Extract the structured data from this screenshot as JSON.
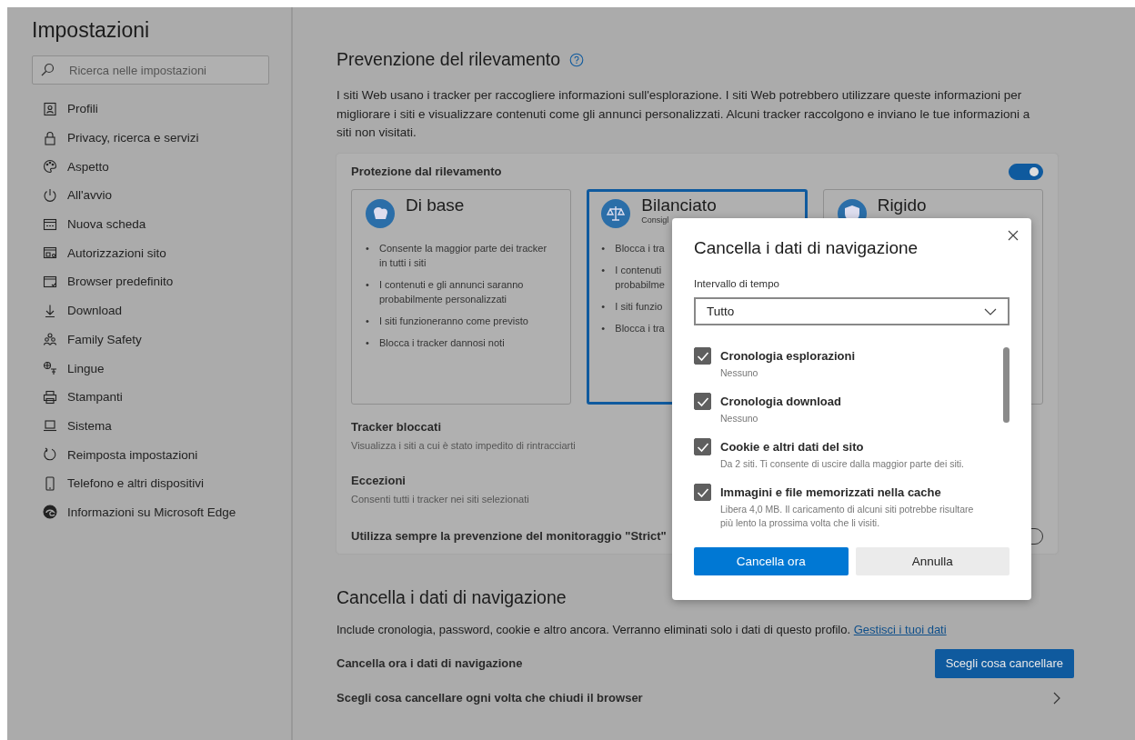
{
  "sidebar": {
    "title": "Impostazioni",
    "search": {
      "placeholder": "Ricerca nelle impostazioni"
    },
    "items": [
      {
        "label": "Profili",
        "selected": false
      },
      {
        "label": "Privacy, ricerca e servizi",
        "selected": false
      },
      {
        "label": "Aspetto",
        "selected": false
      },
      {
        "label": "All'avvio",
        "selected": false
      },
      {
        "label": "Nuova scheda",
        "selected": false
      },
      {
        "label": "Autorizzazioni sito",
        "selected": false
      },
      {
        "label": "Browser predefinito",
        "selected": false
      },
      {
        "label": "Download",
        "selected": false
      },
      {
        "label": "Family Safety",
        "selected": false
      },
      {
        "label": "Lingue",
        "selected": false
      },
      {
        "label": "Stampanti",
        "selected": false
      },
      {
        "label": "Sistema",
        "selected": false
      },
      {
        "label": "Reimposta impostazioni",
        "selected": false
      },
      {
        "label": "Telefono e altri dispositivi",
        "selected": false
      },
      {
        "label": "Informazioni su Microsoft Edge",
        "selected": false
      }
    ]
  },
  "tracking": {
    "heading": "Prevenzione del rilevamento",
    "description": "I siti Web usano i tracker per raccogliere informazioni sull'esplorazione. I siti Web potrebbero utilizzare queste informazioni per migliorare i siti e visualizzare contenuti come gli annunci personalizzati. Alcuni tracker raccolgono e inviano le tue informazioni a siti non visitati.",
    "protection_label": "Protezione dal rilevamento",
    "protection_on": true,
    "bullet_marker": "•",
    "levels": [
      {
        "title": "Di base",
        "selected": false,
        "bullets": [
          "Consente la maggior parte dei tracker in tutti i siti",
          "I contenuti e gli annunci saranno probabilmente personalizzati",
          "I siti funzioneranno come previsto",
          "Blocca i tracker dannosi noti"
        ]
      },
      {
        "title": "Bilanciato",
        "subtitle": "Consigl",
        "selected": true,
        "bullets": [
          "Blocca i tra",
          "I contenuti probabilme",
          "I siti funzio",
          "Blocca i tra"
        ]
      },
      {
        "title": "Rigido",
        "selected": false
      }
    ],
    "rows": [
      {
        "title": "Tracker bloccati",
        "description": "Visualizza i siti a cui è stato impedito di rintracciarti"
      },
      {
        "title": "Eccezioni",
        "description": "Consenti tutti i tracker nei siti selezionati"
      }
    ],
    "strict_label": "Utilizza sempre la prevenzione del monitoraggio \"Strict\"",
    "strict_on": false
  },
  "clear_section": {
    "heading": "Cancella i dati di navigazione",
    "description": "Include cronologia, password, cookie e altro ancora. Verranno eliminati solo i dati di questo profilo.",
    "link": "Gestisci i tuoi dati",
    "now_label": "Cancella ora i dati di navigazione",
    "now_button": "Scegli cosa cancellare",
    "on_close_label": "Scegli cosa cancellare ogni volta che chiudi il browser"
  },
  "dialog": {
    "title": "Cancella i dati di navigazione",
    "range_label": "Intervallo di tempo",
    "range_value": "Tutto",
    "options": [
      {
        "label": "Cronologia esplorazioni",
        "detail": "Nessuno",
        "checked": true
      },
      {
        "label": "Cronologia download",
        "detail": "Nessuno",
        "checked": true
      },
      {
        "label": "Cookie e altri dati del sito",
        "detail": "Da 2 siti. Ti consente di uscire dalla maggior parte dei siti.",
        "checked": true
      },
      {
        "label": "Immagini e file memorizzati nella cache",
        "detail": "Libera 4,0 MB. Il caricamento di alcuni siti potrebbe risultare più lento la prossima volta che li visiti.",
        "checked": true
      }
    ],
    "primary_button": "Cancella ora",
    "secondary_button": "Annulla"
  }
}
